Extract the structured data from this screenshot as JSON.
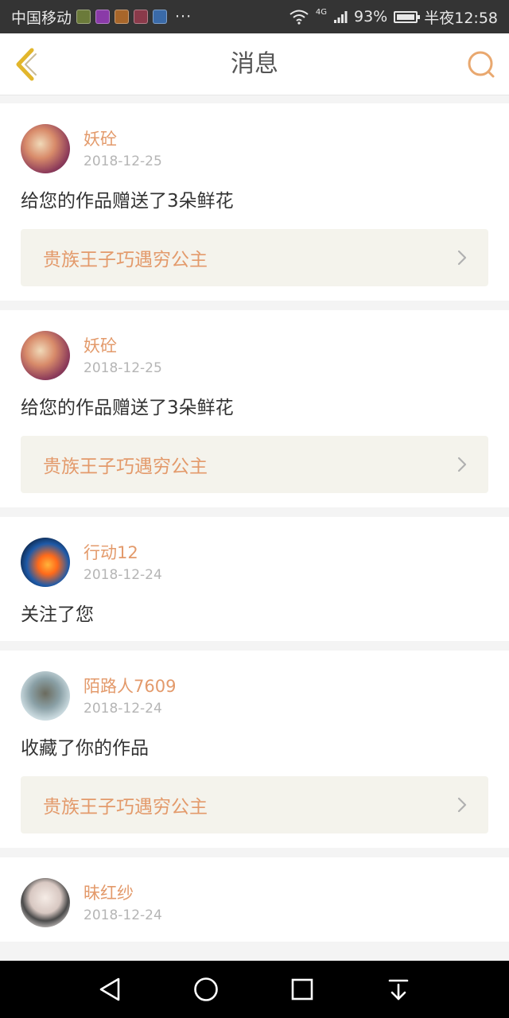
{
  "status_bar": {
    "carrier": "中国移动",
    "more": "···",
    "network": "4G",
    "battery": "93%",
    "time": "半夜12:58"
  },
  "header": {
    "title": "消息"
  },
  "messages": [
    {
      "username": "妖砼",
      "date": "2018-12-25",
      "action": "给您的作品赠送了3朵鲜花",
      "work_title": "贵族王子巧遇穷公主"
    },
    {
      "username": "妖砼",
      "date": "2018-12-25",
      "action": "给您的作品赠送了3朵鲜花",
      "work_title": "贵族王子巧遇穷公主"
    },
    {
      "username": "行动12",
      "date": "2018-12-24",
      "action": "关注了您"
    },
    {
      "username": "陌路人7609",
      "date": "2018-12-24",
      "action": "收藏了你的作品",
      "work_title": "贵族王子巧遇穷公主"
    },
    {
      "username": "昧红纱",
      "date": "2018-12-24"
    }
  ],
  "colors": {
    "accent": "#e39a6b",
    "card_link_bg": "#f4f3ec",
    "page_bg": "#f4f4f4",
    "back_icon": "#e2b62c"
  },
  "icons": {
    "back": "chevron-left-icon",
    "search": "search-icon",
    "nav_back": "triangle-back-icon",
    "nav_home": "circle-home-icon",
    "nav_recent": "square-recent-icon",
    "nav_notifications": "pull-down-icon"
  }
}
